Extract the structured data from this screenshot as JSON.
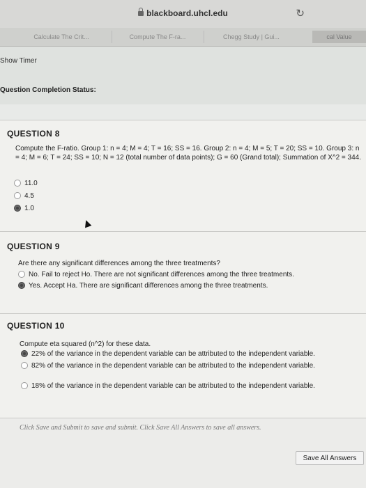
{
  "browser": {
    "url": "blackboard.uhcl.edu",
    "tabs": [
      "Calculate The Crit...",
      "Compute The F-ra...",
      "Chegg Study | Gui...",
      "cal Value"
    ]
  },
  "header": {
    "show_timer": "Show Timer",
    "completion_status": "Question Completion Status:"
  },
  "questions": [
    {
      "header": "QUESTION 8",
      "text": "Compute the F-ratio. Group 1: n = 4; M = 4; T = 16; SS = 16. Group 2: n = 4; M = 5; T = 20; SS = 10. Group 3: n = 4; M = 6; T = 24; SS = 10; N = 12 (total number of data points); G = 60 (Grand total); Summation of X^2 = 344.",
      "options": [
        {
          "label": "11.0",
          "selected": false
        },
        {
          "label": "4.5",
          "selected": false
        },
        {
          "label": "1.0",
          "selected": true
        }
      ]
    },
    {
      "header": "QUESTION 9",
      "text": "Are there any significant differences among the three treatments?",
      "options": [
        {
          "label": "No.  Fail to reject Ho.  There are not significant differences among the three treatments.",
          "selected": false
        },
        {
          "label": "Yes.  Accept Ha.  There are significant differences among the three treatments.",
          "selected": true
        }
      ]
    },
    {
      "header": "QUESTION 10",
      "text": "Compute eta squared (n^2) for these data.",
      "options": [
        {
          "label": "22% of the variance in the dependent variable can be attributed to the independent variable.",
          "selected": true
        },
        {
          "label": "82% of the variance in the dependent variable can be attributed to the independent variable.",
          "selected": false
        },
        {
          "label": "18% of the variance in the dependent variable can be attributed to the independent variable.",
          "selected": false
        }
      ]
    }
  ],
  "footer": {
    "note": "Click Save and Submit to save and submit. Click Save All Answers to save all answers.",
    "save_all": "Save All Answers"
  }
}
